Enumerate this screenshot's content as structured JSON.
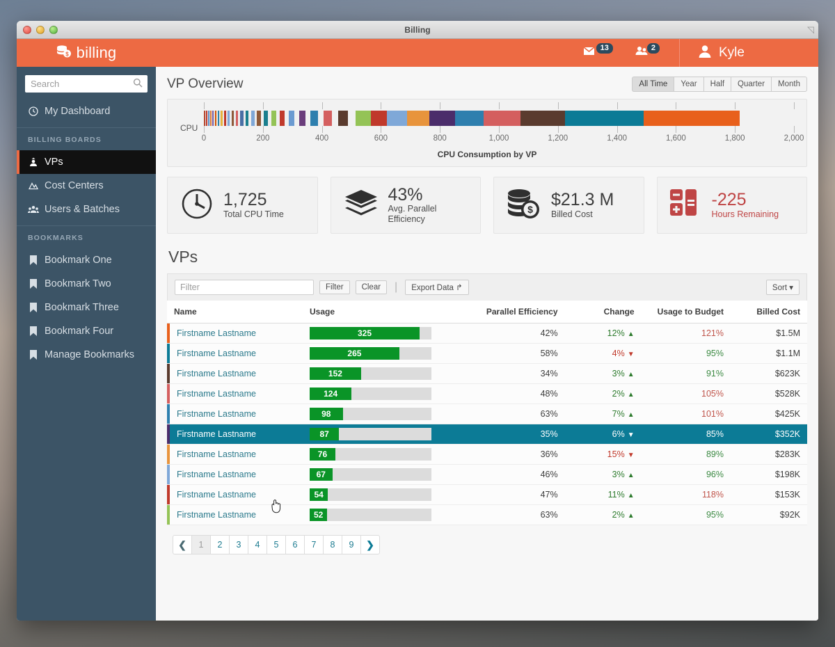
{
  "window": {
    "title": "Billing"
  },
  "topbar": {
    "brand": "billing",
    "brand_icon": "coins-icon",
    "mail_badge": "13",
    "mail_icon": "envelope-icon",
    "users_badge": "2",
    "users_icon": "users-icon",
    "user_name": "Kyle",
    "user_icon": "person-icon",
    "accent": "#ed6a43"
  },
  "sidebar": {
    "search": {
      "placeholder": "Search",
      "value": "",
      "icon": "search-icon"
    },
    "dashboard": {
      "label": "My Dashboard",
      "icon": "clock-icon"
    },
    "boards_label": "BILLING BOARDS",
    "boards": [
      {
        "label": "VPs",
        "icon": "vp-icon",
        "active": true
      },
      {
        "label": "Cost Centers",
        "icon": "cost-center-icon",
        "active": false
      },
      {
        "label": "Users & Batches",
        "icon": "users-group-icon",
        "active": false
      }
    ],
    "bookmarks_label": "BOOKMARKS",
    "bookmarks": [
      {
        "label": "Bookmark One",
        "icon": "bookmark-icon"
      },
      {
        "label": "Bookmark Two",
        "icon": "bookmark-icon"
      },
      {
        "label": "Bookmark Three",
        "icon": "bookmark-icon"
      },
      {
        "label": "Bookmark Four",
        "icon": "bookmark-icon"
      },
      {
        "label": "Manage Bookmarks",
        "icon": "bookmark-icon"
      }
    ]
  },
  "page": {
    "title": "VP Overview",
    "time_filters": [
      {
        "label": "All Time",
        "selected": true
      },
      {
        "label": "Year",
        "selected": false
      },
      {
        "label": "Half",
        "selected": false
      },
      {
        "label": "Quarter",
        "selected": false
      },
      {
        "label": "Month",
        "selected": false
      }
    ]
  },
  "chart_data": {
    "type": "bar",
    "orientation": "horizontal-stacked",
    "title": "CPU Consumption by VP",
    "xlabel": "",
    "ylabel": "CPU",
    "categories": [
      "CPU"
    ],
    "xlim": [
      0,
      2000
    ],
    "xticks": [
      0,
      200,
      400,
      600,
      800,
      1000,
      1200,
      1400,
      1600,
      1800,
      2000
    ],
    "xtick_labels": [
      "0",
      "200",
      "400",
      "600",
      "800",
      "1,000",
      "1,200",
      "1,400",
      "1,600",
      "1,800",
      "2,000"
    ],
    "grid": false,
    "legend": "none",
    "total": 1725,
    "segments": [
      {
        "value": 4,
        "color": "#b5472e"
      },
      {
        "value": 3,
        "color": "#e2e2e2"
      },
      {
        "value": 4,
        "color": "#c0392b"
      },
      {
        "value": 3,
        "color": "#eeeeee"
      },
      {
        "value": 4,
        "color": "#5a8fc8"
      },
      {
        "value": 3,
        "color": "#dddddd"
      },
      {
        "value": 5,
        "color": "#e07b39"
      },
      {
        "value": 3,
        "color": "#e8e8e8"
      },
      {
        "value": 5,
        "color": "#7b5ea7"
      },
      {
        "value": 4,
        "color": "#e4e4e4"
      },
      {
        "value": 5,
        "color": "#d35400"
      },
      {
        "value": 4,
        "color": "#eeeeee"
      },
      {
        "value": 6,
        "color": "#2e86ab"
      },
      {
        "value": 4,
        "color": "#e6e6e6"
      },
      {
        "value": 6,
        "color": "#e8b33c"
      },
      {
        "value": 5,
        "color": "#ededed"
      },
      {
        "value": 7,
        "color": "#c0392b"
      },
      {
        "value": 5,
        "color": "#e9e9e9"
      },
      {
        "value": 8,
        "color": "#7fa8d8"
      },
      {
        "value": 6,
        "color": "#ececec"
      },
      {
        "value": 8,
        "color": "#8e5a3a"
      },
      {
        "value": 6,
        "color": "#eaeaea"
      },
      {
        "value": 9,
        "color": "#d45f5f"
      },
      {
        "value": 7,
        "color": "#efefef"
      },
      {
        "value": 10,
        "color": "#4a6fa5"
      },
      {
        "value": 7,
        "color": "#ececec"
      },
      {
        "value": 11,
        "color": "#1a7f8e"
      },
      {
        "value": 8,
        "color": "#efefef"
      },
      {
        "value": 12,
        "color": "#7fa8d8"
      },
      {
        "value": 9,
        "color": "#ececec"
      },
      {
        "value": 13,
        "color": "#8e5a3a"
      },
      {
        "value": 10,
        "color": "#f0f0f0"
      },
      {
        "value": 14,
        "color": "#1a7f8e"
      },
      {
        "value": 11,
        "color": "#efefef"
      },
      {
        "value": 16,
        "color": "#94c356"
      },
      {
        "value": 12,
        "color": "#f0f0f0"
      },
      {
        "value": 18,
        "color": "#c0392b"
      },
      {
        "value": 13,
        "color": "#efefef"
      },
      {
        "value": 20,
        "color": "#6b9bd1"
      },
      {
        "value": 15,
        "color": "#f0f0f0"
      },
      {
        "value": 22,
        "color": "#6a3d7c"
      },
      {
        "value": 17,
        "color": "#f1f1f1"
      },
      {
        "value": 25,
        "color": "#2e7fae"
      },
      {
        "value": 20,
        "color": "#f0f0f0"
      },
      {
        "value": 28,
        "color": "#d45f5f"
      },
      {
        "value": 22,
        "color": "#f1f1f1"
      },
      {
        "value": 33,
        "color": "#5a3b2e"
      },
      {
        "value": 26,
        "color": "#f1f1f1"
      },
      {
        "value": 52,
        "color": "#94c356"
      },
      {
        "value": 54,
        "color": "#c0392b"
      },
      {
        "value": 67,
        "color": "#7fa8d8"
      },
      {
        "value": 76,
        "color": "#e8943c"
      },
      {
        "value": 87,
        "color": "#4b2d6b"
      },
      {
        "value": 98,
        "color": "#2e7fae"
      },
      {
        "value": 124,
        "color": "#d45f5f"
      },
      {
        "value": 152,
        "color": "#5a3b2e"
      },
      {
        "value": 265,
        "color": "#0c7b96"
      },
      {
        "value": 325,
        "color": "#e8601c"
      }
    ]
  },
  "stats": [
    {
      "value": "1,725",
      "label": "Total CPU Time",
      "icon": "clock-icon",
      "tone": "normal"
    },
    {
      "value": "43%",
      "label": "Avg. Parallel Efficiency",
      "icon": "layers-icon",
      "tone": "normal"
    },
    {
      "value": "$21.3 M",
      "label": "Billed Cost",
      "icon": "coins-icon",
      "tone": "normal"
    },
    {
      "value": "-225",
      "label": "Hours Remaining",
      "icon": "calculator-icon",
      "tone": "danger",
      "color": "#bf4545"
    }
  ],
  "table_section": {
    "title": "VPs",
    "toolbar": {
      "filter_placeholder": "Filter",
      "filter_value": "",
      "filter_button": "Filter",
      "clear_button": "Clear",
      "export_button": "Export Data",
      "export_icon": "share-arrow-icon",
      "sort_button": "Sort",
      "sort_icon": "caret-down-icon"
    },
    "columns": [
      "Name",
      "Usage",
      "Parallel Efficiency",
      "Change",
      "Usage to Budget",
      "Billed Cost"
    ],
    "usage_max": 360,
    "rows": [
      {
        "name": "Firstname Lastname",
        "usage": "325",
        "usage_num": 325,
        "efficiency": "42%",
        "change": "12%",
        "change_dir": "up",
        "budget": "121%",
        "budget_over": true,
        "cost": "$1.5M",
        "accent": "#e8601c",
        "selected": false
      },
      {
        "name": "Firstname Lastname",
        "usage": "265",
        "usage_num": 265,
        "efficiency": "58%",
        "change": "4%",
        "change_dir": "down",
        "budget": "95%",
        "budget_over": false,
        "cost": "$1.1M",
        "accent": "#0c7b96",
        "selected": false
      },
      {
        "name": "Firstname Lastname",
        "usage": "152",
        "usage_num": 152,
        "efficiency": "34%",
        "change": "3%",
        "change_dir": "up",
        "budget": "91%",
        "budget_over": false,
        "cost": "$623K",
        "accent": "#5a3b2e",
        "selected": false
      },
      {
        "name": "Firstname Lastname",
        "usage": "124",
        "usage_num": 124,
        "efficiency": "48%",
        "change": "2%",
        "change_dir": "up",
        "budget": "105%",
        "budget_over": true,
        "cost": "$528K",
        "accent": "#d45f5f",
        "selected": false
      },
      {
        "name": "Firstname Lastname",
        "usage": "98",
        "usage_num": 98,
        "efficiency": "63%",
        "change": "7%",
        "change_dir": "up",
        "budget": "101%",
        "budget_over": true,
        "cost": "$425K",
        "accent": "#2e7fae",
        "selected": false
      },
      {
        "name": "Firstname Lastname",
        "usage": "87",
        "usage_num": 87,
        "efficiency": "35%",
        "change": "6%",
        "change_dir": "down",
        "budget": "85%",
        "budget_over": false,
        "cost": "$352K",
        "accent": "#4b2d6b",
        "selected": true
      },
      {
        "name": "Firstname Lastname",
        "usage": "76",
        "usage_num": 76,
        "efficiency": "36%",
        "change": "15%",
        "change_dir": "down",
        "budget": "89%",
        "budget_over": false,
        "cost": "$283K",
        "accent": "#e8943c",
        "selected": false
      },
      {
        "name": "Firstname Lastname",
        "usage": "67",
        "usage_num": 67,
        "efficiency": "46%",
        "change": "3%",
        "change_dir": "up",
        "budget": "96%",
        "budget_over": false,
        "cost": "$198K",
        "accent": "#7fa8d8",
        "selected": false
      },
      {
        "name": "Firstname Lastname",
        "usage": "54",
        "usage_num": 54,
        "efficiency": "47%",
        "change": "11%",
        "change_dir": "up",
        "budget": "118%",
        "budget_over": true,
        "cost": "$153K",
        "accent": "#c0392b",
        "selected": false
      },
      {
        "name": "Firstname Lastname",
        "usage": "52",
        "usage_num": 52,
        "efficiency": "63%",
        "change": "2%",
        "change_dir": "up",
        "budget": "95%",
        "budget_over": false,
        "cost": "$92K",
        "accent": "#94c356",
        "selected": false
      }
    ],
    "pagination": {
      "prev_icon": "chevron-left-icon",
      "next_icon": "chevron-right-icon",
      "pages": [
        "1",
        "2",
        "3",
        "4",
        "5",
        "6",
        "7",
        "8",
        "9"
      ],
      "current": "1"
    }
  }
}
